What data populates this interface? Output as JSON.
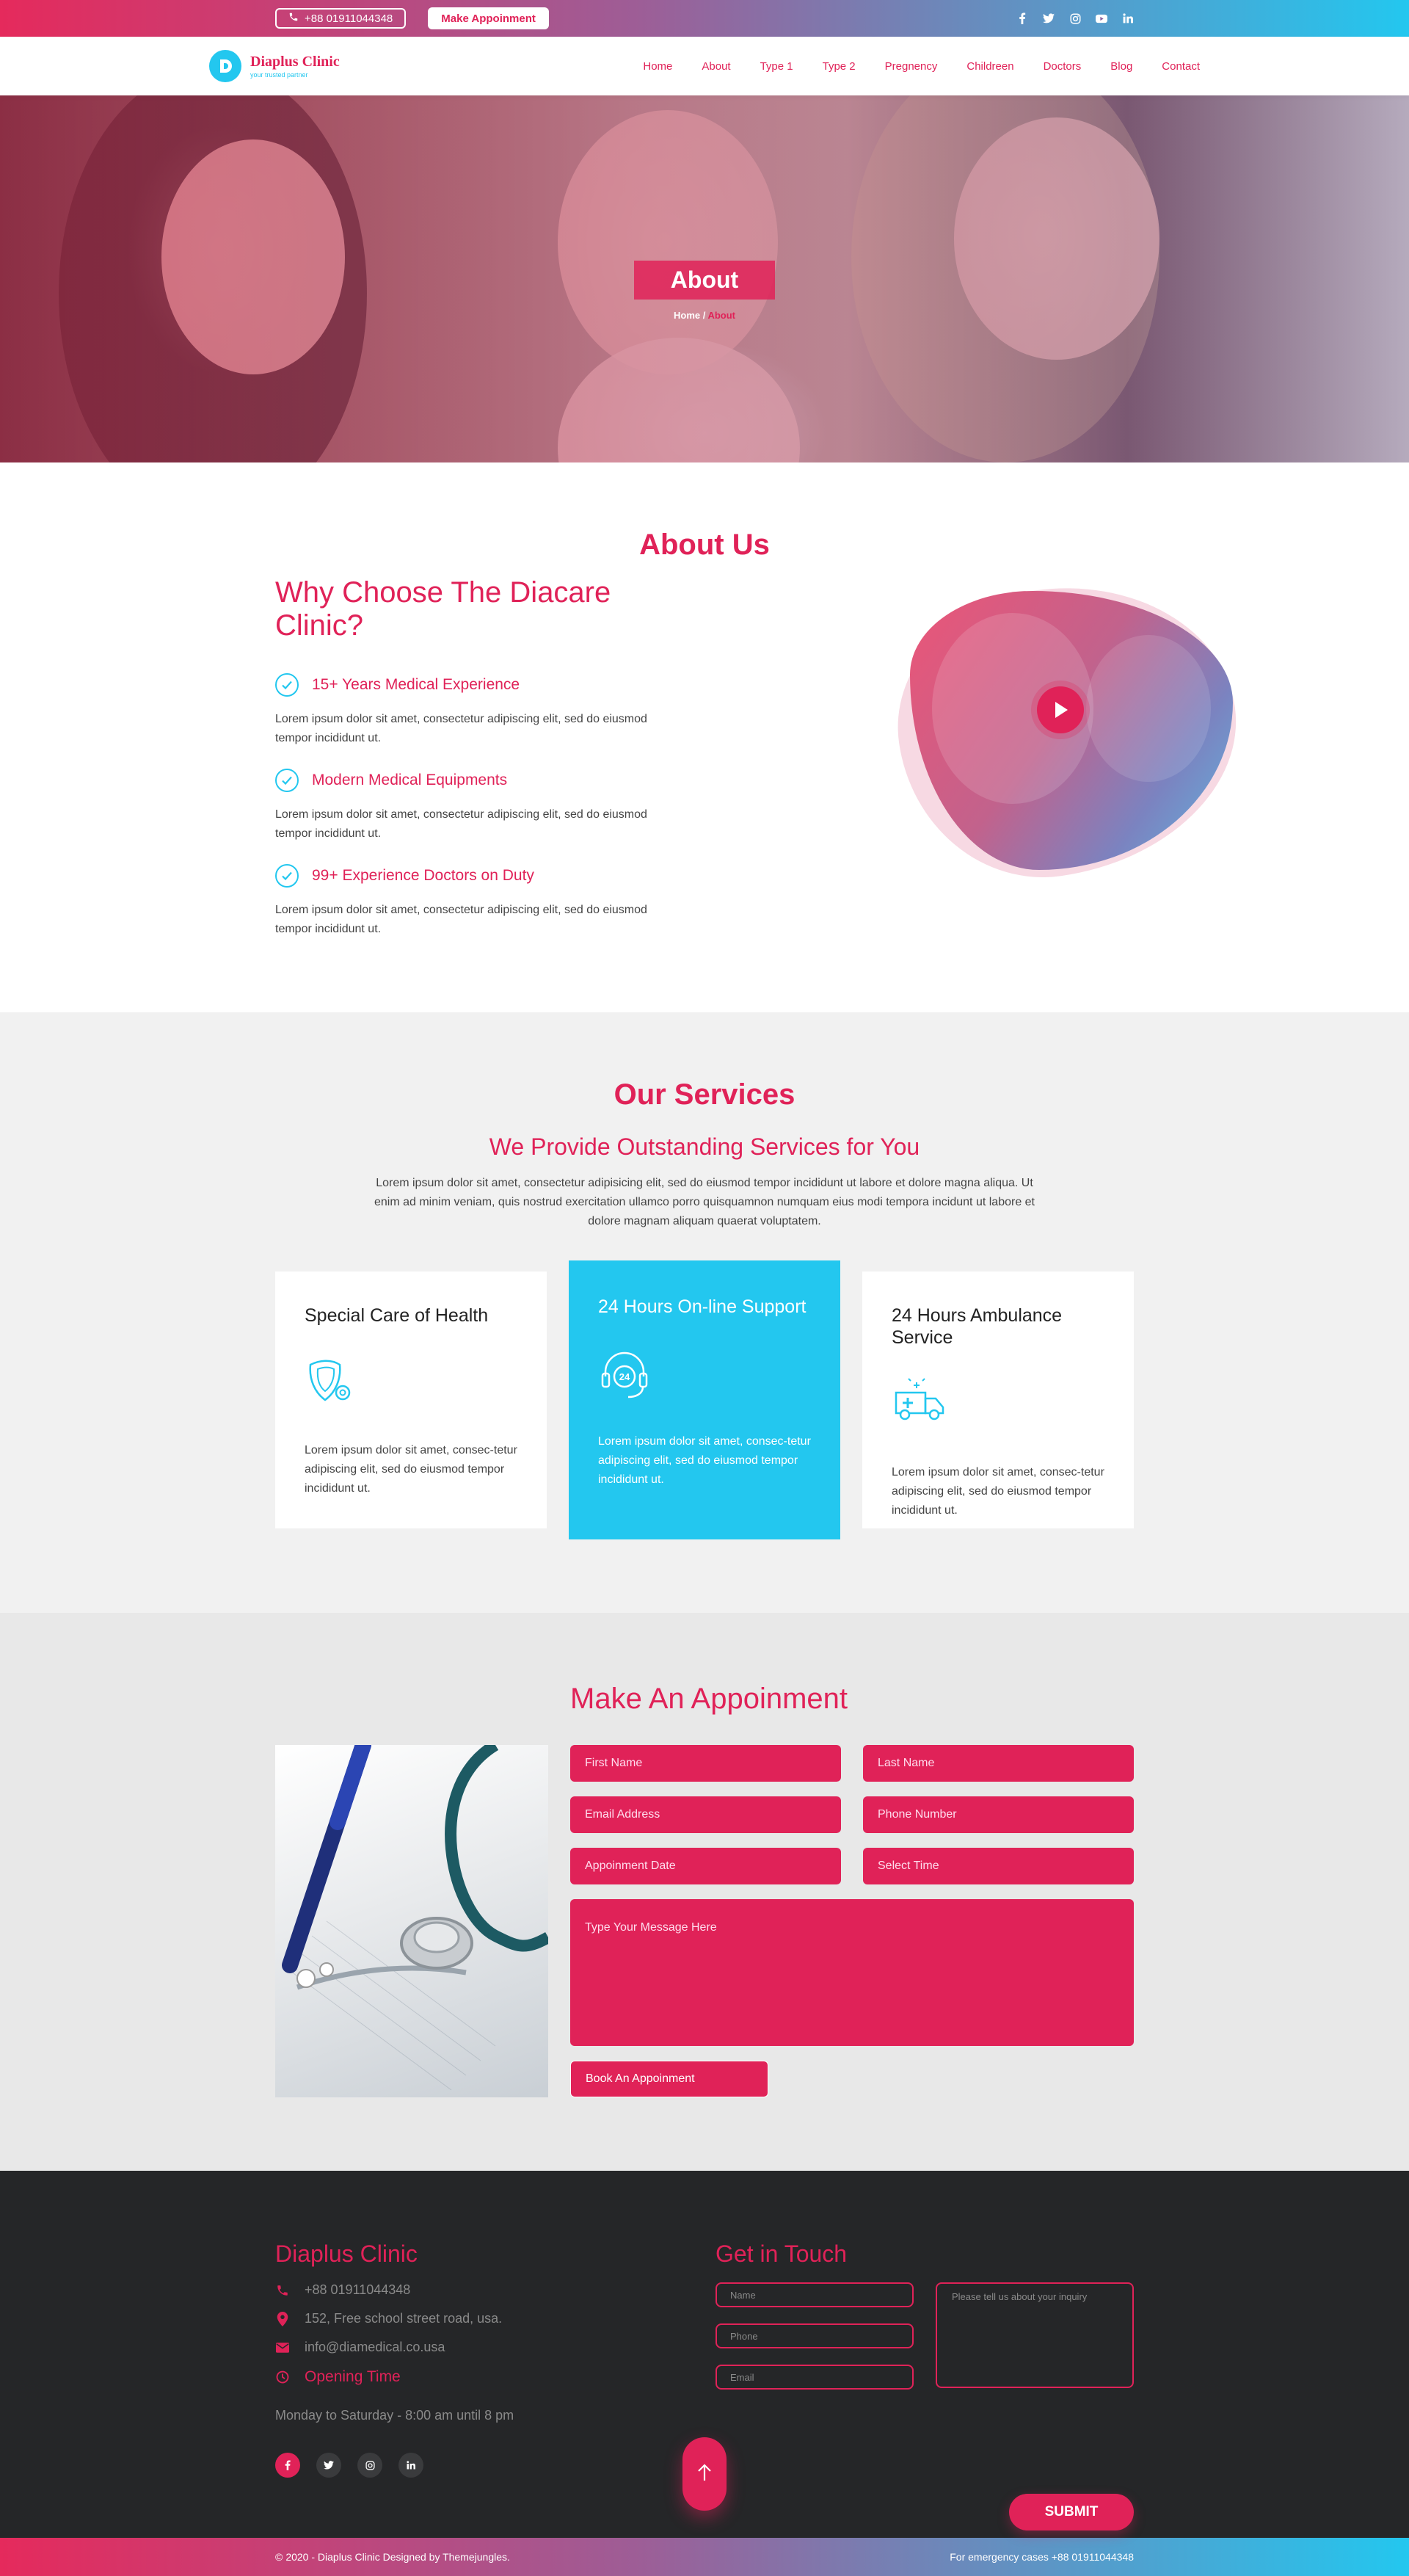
{
  "topbar": {
    "phone": "+88 01911044348",
    "appointment_label": "Make Appoinment",
    "socials": [
      "facebook-icon",
      "twitter-icon",
      "instagram-icon",
      "youtube-icon",
      "linkedin-icon"
    ]
  },
  "nav": {
    "logo_title": "Diaplus Clinic",
    "logo_tagline": "your trusted partner",
    "items": [
      "Home",
      "About",
      "Type 1",
      "Type 2",
      "Pregnency",
      "Childreen",
      "Doctors",
      "Blog",
      "Contact"
    ]
  },
  "hero": {
    "title": "About",
    "crumb_home": "Home",
    "crumb_sep": " / ",
    "crumb_current": "About"
  },
  "about": {
    "section_title": "About Us",
    "heading": "Why Choose The Diacare Clinic?",
    "features": [
      {
        "title": "15+ Years Medical Experience",
        "text": "Lorem ipsum dolor sit amet, consectetur adipiscing elit, sed do eiusmod tempor incididunt ut."
      },
      {
        "title": "Modern Medical Equipments",
        "text": "Lorem ipsum dolor sit amet, consectetur adipiscing elit, sed do eiusmod tempor incididunt ut."
      },
      {
        "title": "99+ Experience Doctors on Duty",
        "text": "Lorem ipsum dolor sit amet, consectetur adipiscing elit, sed do eiusmod tempor incididunt ut."
      }
    ]
  },
  "services": {
    "section_title": "Our Services",
    "heading": "We Provide Outstanding Services for You",
    "intro": "Lorem ipsum dolor sit amet, consectetur adipisicing elit, sed do eiusmod tempor incididunt ut labore et dolore magna aliqua. Ut enim ad minim veniam, quis nostrud exercitation ullamco  porro quisquamnon numquam eius modi tempora incidunt ut labore et dolore magnam aliquam quaerat voluptatem.",
    "cards": [
      {
        "title": "Special Care of Health",
        "icon": "shield-care-icon",
        "text": "Lorem ipsum dolor sit amet, consec-tetur adipiscing elit, sed do eiusmod tempor incididunt ut."
      },
      {
        "title": "24 Hours On-line Support",
        "icon": "headset-24-icon",
        "text": "Lorem ipsum dolor sit amet, consec-tetur adipiscing elit, sed do eiusmod tempor incididunt ut."
      },
      {
        "title": "24 Hours Ambulance Service",
        "icon": "ambulance-icon",
        "text": "Lorem ipsum dolor sit amet, consec-tetur adipiscing elit, sed do eiusmod tempor incididunt ut."
      }
    ]
  },
  "appointment": {
    "title": "Make An Appoinment",
    "first_name": "First Name",
    "last_name": "Last Name",
    "email": "Email Address",
    "phone": "Phone Number",
    "date": "Appoinment Date",
    "time": "Select Time",
    "message": "Type Your Message Here",
    "button": "Book An Appoinment"
  },
  "footer": {
    "brand": "Diaplus Clinic",
    "phone": "+88 01911044348",
    "address": "152, Free school street road, usa.",
    "email": "info@diamedical.co.usa",
    "opening_label": "Opening Time",
    "hours": "Monday to Saturday - 8:00 am until 8 pm",
    "get_in_touch": "Get in Touch",
    "name_placeholder": "Name",
    "phone_placeholder": "Phone",
    "email_placeholder": "Email",
    "inquiry_placeholder": "Please tell us about your inquiry",
    "submit": "SUBMIT",
    "copyright": "2020 - Diaplus Clinic Designed by Themejungles.",
    "emergency": "For emergency cases +88 01911044348"
  },
  "colors": {
    "primary": "#e02258",
    "accent": "#23c7ef",
    "dark": "#252628"
  }
}
